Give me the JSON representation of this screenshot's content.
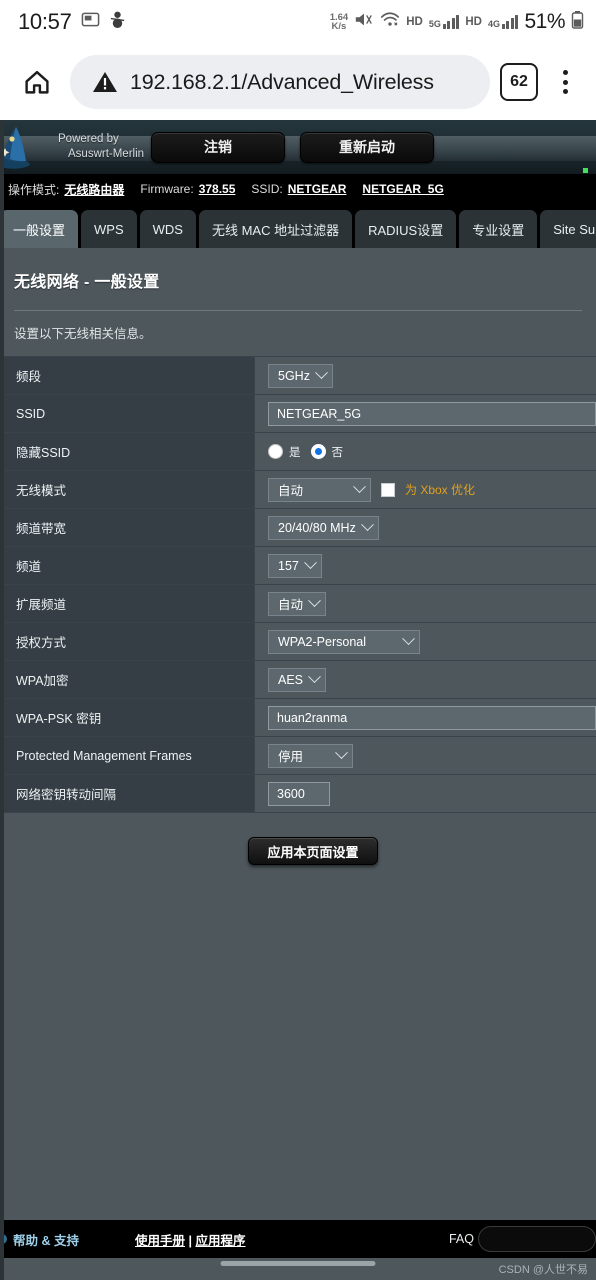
{
  "status_bar": {
    "clock": "10:57",
    "net_rate_value": "1.64",
    "net_rate_unit": "K/s",
    "hd_label_1": "HD",
    "net_label_1": "5G",
    "hd_label_2": "HD",
    "net_label_2": "4G",
    "battery": "51%",
    "icons": [
      "screenshot-icon",
      "snowman-icon",
      "mute-icon",
      "wifi-icon",
      "signal-icon",
      "battery-icon"
    ]
  },
  "browser": {
    "url": "192.168.2.1/Advanced_Wireless",
    "tab_count": "62",
    "security_icon": "warning-triangle-icon",
    "home_icon": "home-icon",
    "menu_icon": "overflow-menu-icon"
  },
  "banner": {
    "powered_by_line1": "Powered by",
    "powered_by_line2": "Asuswrt-Merlin",
    "logout_label": "注销",
    "reboot_label": "重新启动"
  },
  "opmode": {
    "mode_label": "操作模式:",
    "mode_value": "无线路由器",
    "firmware_label": "Firmware:",
    "firmware_value": "378.55",
    "ssid_label": "SSID:",
    "ssid_value_1": "NETGEAR",
    "ssid_value_2": "NETGEAR_5G"
  },
  "tabs": [
    {
      "label": "一般设置",
      "active": true
    },
    {
      "label": "WPS",
      "active": false
    },
    {
      "label": "WDS",
      "active": false
    },
    {
      "label": "无线 MAC 地址过滤器",
      "active": false
    },
    {
      "label": "RADIUS设置",
      "active": false
    },
    {
      "label": "专业设置",
      "active": false
    },
    {
      "label": "Site Survey",
      "active": false
    }
  ],
  "section": {
    "title": "无线网络 - 一般设置",
    "description": "设置以下无线相关信息。"
  },
  "fields": {
    "band_label": "频段",
    "band_value": "5GHz",
    "ssid_label": "SSID",
    "ssid_value": "NETGEAR_5G",
    "hide_ssid_label": "隐藏SSID",
    "hide_ssid_yes": "是",
    "hide_ssid_no": "否",
    "wireless_mode_label": "无线模式",
    "wireless_mode_value": "自动",
    "xbox_label": "为 Xbox 优化",
    "bandwidth_label": "频道带宽",
    "bandwidth_value": "20/40/80 MHz",
    "channel_label": "频道",
    "channel_value": "157",
    "ext_channel_label": "扩展频道",
    "ext_channel_value": "自动",
    "auth_label": "授权方式",
    "auth_value": "WPA2-Personal",
    "wpa_enc_label": "WPA加密",
    "wpa_enc_value": "AES",
    "psk_label": "WPA-PSK 密钥",
    "psk_value": "huan2ranma",
    "pmf_label": "Protected Management Frames",
    "pmf_value": "停用",
    "rotate_label": "网络密钥转动间隔",
    "rotate_value": "3600"
  },
  "apply": {
    "label": "应用本页面设置"
  },
  "footer": {
    "help_support": "帮助 & 支持",
    "manual": "使用手册",
    "separator": "|",
    "apps": "应用程序",
    "faq": "FAQ"
  },
  "watermark": "CSDN @人世不易",
  "colors": {
    "page_bg": "#4d575c",
    "key_bg": "#343e44",
    "control_bg": "#5d686e",
    "banner_dark": "#121b1f",
    "accent_orange": "#e3a11c",
    "radio_blue": "#1273e6",
    "help_blue": "#9fd0ea"
  }
}
